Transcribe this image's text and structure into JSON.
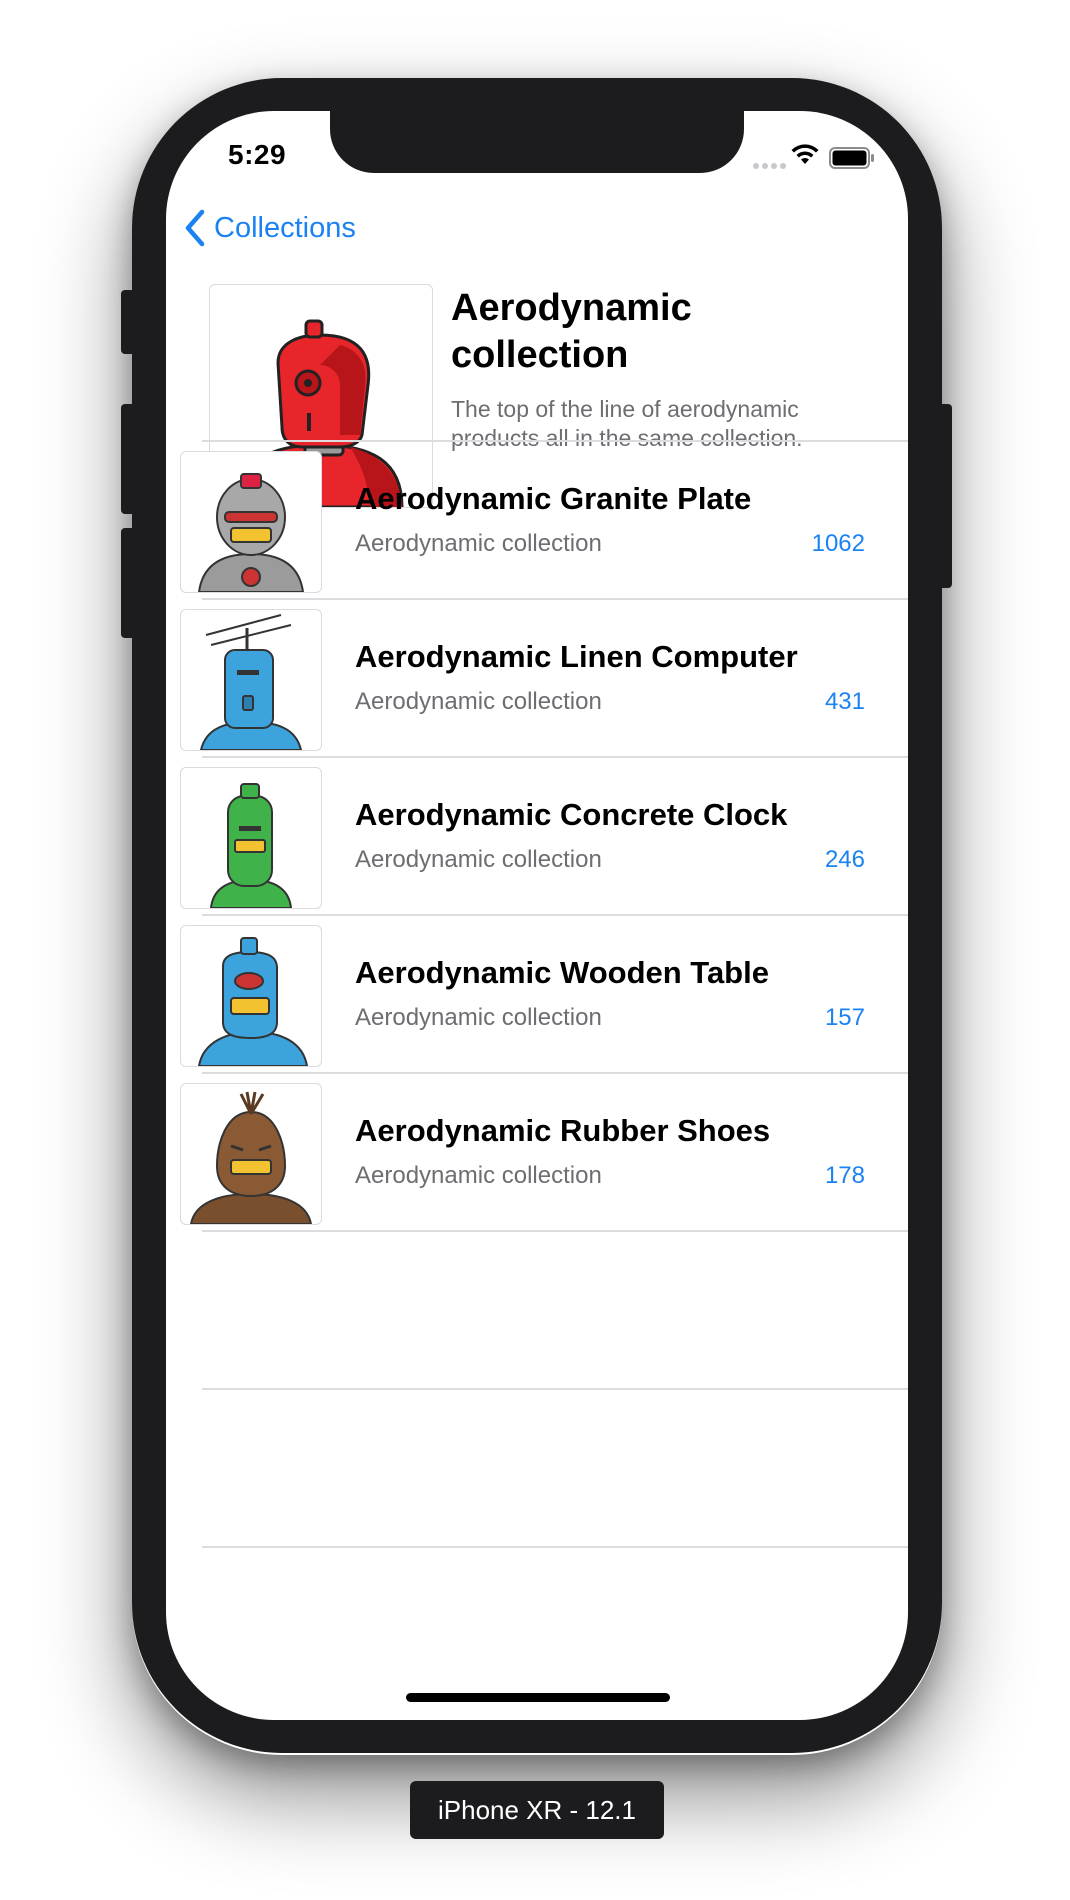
{
  "status_bar": {
    "time": "5:29"
  },
  "nav": {
    "back_label": "Collections"
  },
  "collection": {
    "title": "Aerodynamic collection",
    "description": "The top of the line of aerodynamic products all in the same collection."
  },
  "products": [
    {
      "title": "Aerodynamic Granite Plate",
      "collection": "Aerodynamic collection",
      "count": "1062",
      "icon": "gray-robot-icon"
    },
    {
      "title": "Aerodynamic Linen Computer",
      "collection": "Aerodynamic collection",
      "count": "431",
      "icon": "blue-antenna-robot-icon"
    },
    {
      "title": "Aerodynamic Concrete Clock",
      "collection": "Aerodynamic collection",
      "count": "246",
      "icon": "green-robot-icon"
    },
    {
      "title": "Aerodynamic Wooden Table",
      "collection": "Aerodynamic collection",
      "count": "157",
      "icon": "blue-robot-icon"
    },
    {
      "title": "Aerodynamic Rubber Shoes",
      "collection": "Aerodynamic collection",
      "count": "178",
      "icon": "brown-robot-icon"
    }
  ],
  "simulator_label": "iPhone XR - 12.1",
  "colors": {
    "accent": "#1a82f2",
    "secondary_text": "#6d6d72",
    "frame": "#1c1c1e"
  }
}
